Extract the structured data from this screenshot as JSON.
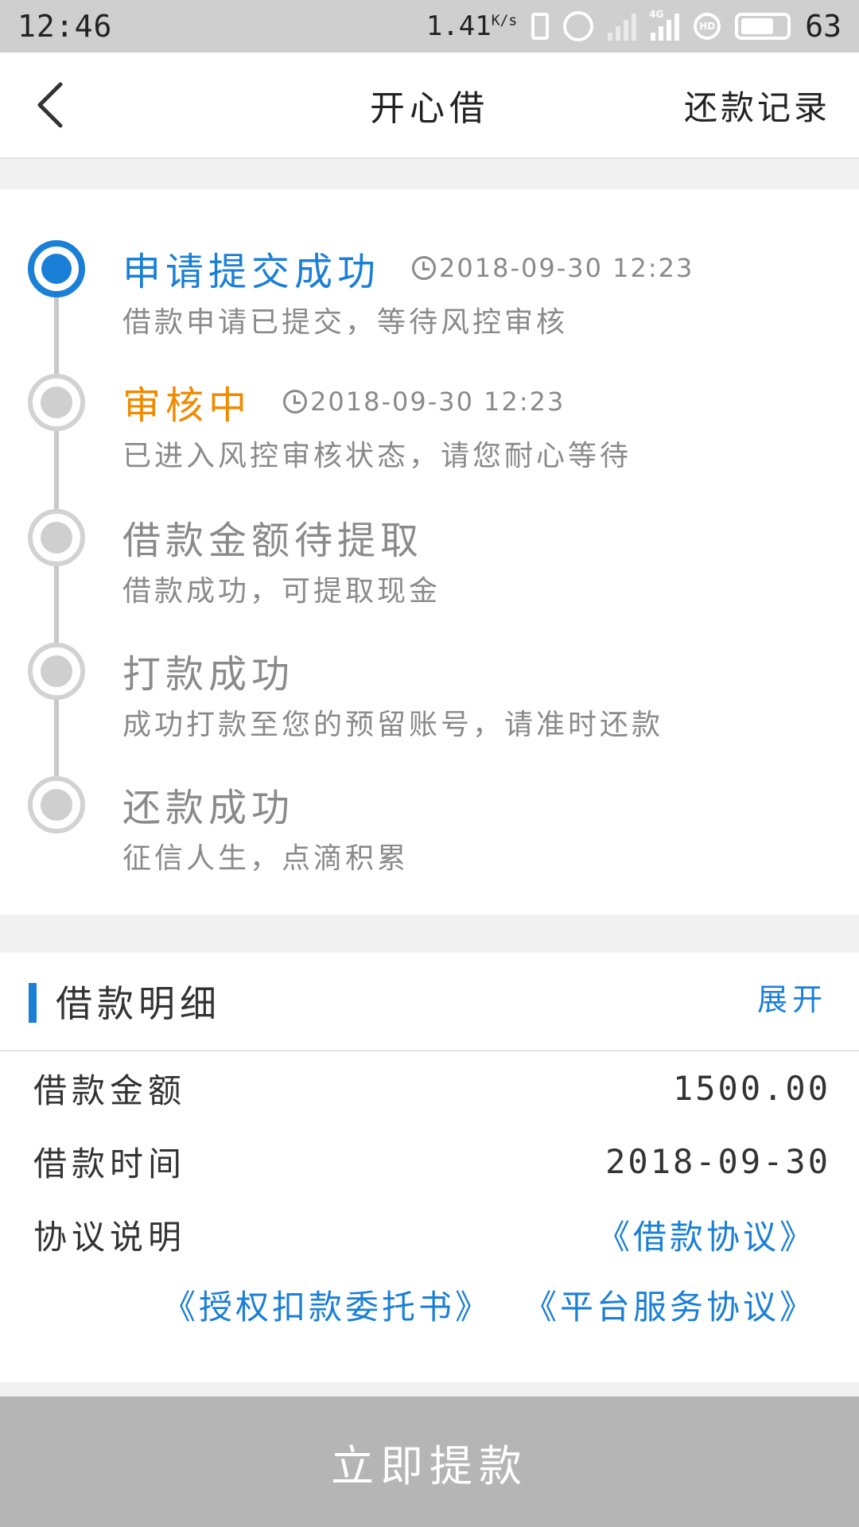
{
  "status_bar": {
    "time": "12:46",
    "speed": "1.41",
    "speed_unit": "K/s",
    "network_label": "4G",
    "hd_label": "HD",
    "battery": "63"
  },
  "nav": {
    "title": "开心借",
    "right_action": "还款记录"
  },
  "timeline": {
    "steps": [
      {
        "title": "申请提交成功",
        "time": "2018-09-30 12:23",
        "desc": "借款申请已提交，等待风控审核",
        "state": "done"
      },
      {
        "title": "审核中",
        "time": "2018-09-30 12:23",
        "desc": "已进入风控审核状态，请您耐心等待",
        "state": "current"
      },
      {
        "title": "借款金额待提取",
        "time": "",
        "desc": "借款成功，可提取现金",
        "state": "pending"
      },
      {
        "title": "打款成功",
        "time": "",
        "desc": "成功打款至您的预留账号，请准时还款",
        "state": "pending"
      },
      {
        "title": "还款成功",
        "time": "",
        "desc": "征信人生，点滴积累",
        "state": "pending"
      }
    ]
  },
  "detail": {
    "title": "借款明细",
    "expand_label": "展开",
    "rows": [
      {
        "label": "借款金额",
        "value": "1500.00"
      },
      {
        "label": "借款时间",
        "value": "2018-09-30"
      }
    ],
    "agreement_label": "协议说明",
    "agreements": [
      "《借款协议》",
      "《授权扣款委托书》",
      "《平台服务协议》"
    ]
  },
  "submit_label": "立即提款",
  "colors": {
    "accent": "#1a7fd6",
    "in_progress": "#f08a00",
    "pending": "#8a8a8a",
    "button_disabled": "#b5b5b5"
  }
}
